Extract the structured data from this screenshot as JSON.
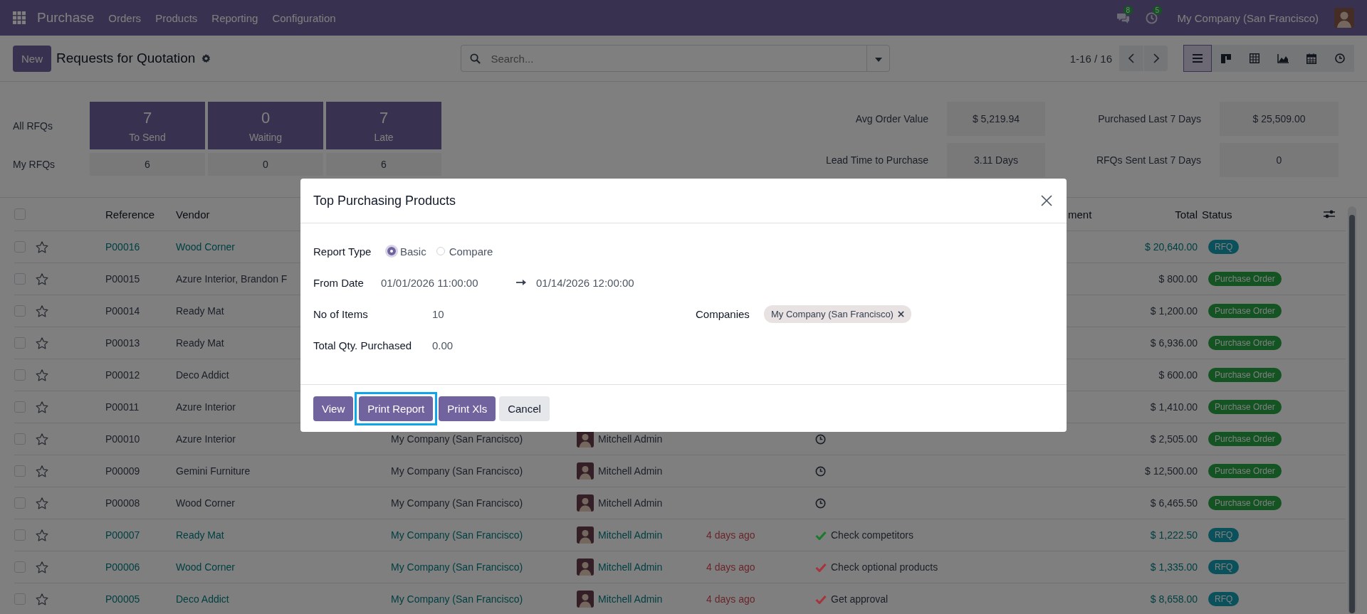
{
  "navbar": {
    "app": "Purchase",
    "menu": [
      "Orders",
      "Products",
      "Reporting",
      "Configuration"
    ],
    "messages_count": "8",
    "activities_count": "5",
    "company": "My Company (San Francisco)"
  },
  "control_panel": {
    "new_button": "New",
    "title": "Requests for Quotation",
    "search": {
      "placeholder": "Search..."
    },
    "pager": "1-16 / 16",
    "views": [
      {
        "kind": "list",
        "selected": true
      },
      {
        "kind": "kanban",
        "selected": false
      },
      {
        "kind": "pivot",
        "selected": false
      },
      {
        "kind": "graph",
        "selected": false
      },
      {
        "kind": "calendar",
        "selected": false
      },
      {
        "kind": "activity",
        "selected": false
      }
    ]
  },
  "dashboard": {
    "row_labels": [
      "All RFQs",
      "My RFQs"
    ],
    "tiles": [
      {
        "count": "7",
        "label": "To Send",
        "mine": "6"
      },
      {
        "count": "0",
        "label": "Waiting",
        "mine": "0"
      },
      {
        "count": "7",
        "label": "Late",
        "mine": "6"
      }
    ],
    "kpis": [
      {
        "label": "Avg Order Value",
        "value": "$ 5,219.94"
      },
      {
        "label": "Purchased Last 7 Days",
        "value": "$ 25,509.00"
      },
      {
        "label": "Lead Time to Purchase",
        "value": "3.11 Days"
      },
      {
        "label": "RFQs Sent Last 7 Days",
        "value": "0"
      }
    ]
  },
  "table": {
    "all_checked": false,
    "columns": {
      "reference": "Reference",
      "vendor": "Vendor",
      "activity": "ment",
      "total": "Total",
      "status": "Status"
    },
    "rows": [
      {
        "checked": false,
        "starred": false,
        "highlighted": true,
        "reference": "P00016",
        "vendor": "Wood Corner",
        "total": "$ 20,640.00",
        "status": {
          "label": "RFQ",
          "kind": "rfq"
        }
      },
      {
        "checked": false,
        "starred": false,
        "highlighted": false,
        "reference": "P00015",
        "vendor": "Azure Interior, Brandon F",
        "total": "$ 800.00",
        "status": {
          "label": "Purchase Order",
          "kind": "purchase"
        }
      },
      {
        "checked": false,
        "starred": false,
        "highlighted": false,
        "reference": "P00014",
        "vendor": "Ready Mat",
        "total": "$ 1,200.00",
        "status": {
          "label": "Purchase Order",
          "kind": "purchase"
        }
      },
      {
        "checked": false,
        "starred": false,
        "highlighted": false,
        "reference": "P00013",
        "vendor": "Ready Mat",
        "total": "$ 6,936.00",
        "status": {
          "label": "Purchase Order",
          "kind": "purchase"
        }
      },
      {
        "checked": false,
        "starred": false,
        "highlighted": false,
        "reference": "P00012",
        "vendor": "Deco Addict",
        "total": "$ 600.00",
        "status": {
          "label": "Purchase Order",
          "kind": "purchase"
        }
      },
      {
        "checked": false,
        "starred": false,
        "highlighted": false,
        "reference": "P00011",
        "vendor": "Azure Interior",
        "total": "$ 1,410.00",
        "status": {
          "label": "Purchase Order",
          "kind": "purchase"
        }
      },
      {
        "checked": false,
        "starred": false,
        "highlighted": false,
        "reference": "P00010",
        "vendor": "Azure Interior",
        "company": "My Company (San Francisco)",
        "buyer": "Mitchell Admin",
        "activity": {
          "kind": "clock"
        },
        "total": "$ 2,505.00",
        "status": {
          "label": "Purchase Order",
          "kind": "purchase"
        }
      },
      {
        "checked": false,
        "starred": false,
        "highlighted": false,
        "reference": "P00009",
        "vendor": "Gemini Furniture",
        "company": "My Company (San Francisco)",
        "buyer": "Mitchell Admin",
        "activity": {
          "kind": "clock"
        },
        "total": "$ 12,500.00",
        "status": {
          "label": "Purchase Order",
          "kind": "purchase"
        }
      },
      {
        "checked": false,
        "starred": false,
        "highlighted": false,
        "reference": "P00008",
        "vendor": "Wood Corner",
        "company": "My Company (San Francisco)",
        "buyer": "Mitchell Admin",
        "activity": {
          "kind": "clock"
        },
        "total": "$ 6,465.50",
        "status": {
          "label": "Purchase Order",
          "kind": "purchase"
        }
      },
      {
        "checked": false,
        "starred": false,
        "highlighted": true,
        "reference": "P00007",
        "vendor": "Ready Mat",
        "company": "My Company (San Francisco)",
        "buyer": "Mitchell Admin",
        "deadline": "4 days ago",
        "activity": {
          "kind": "check",
          "color": "#1a7a2a",
          "text": "Check competitors"
        },
        "total": "$ 1,222.50",
        "status": {
          "label": "RFQ",
          "kind": "rfq"
        }
      },
      {
        "checked": false,
        "starred": false,
        "highlighted": true,
        "reference": "P00006",
        "vendor": "Wood Corner",
        "company": "My Company (San Francisco)",
        "buyer": "Mitchell Admin",
        "deadline": "4 days ago",
        "activity": {
          "kind": "check",
          "color": "#a8333d",
          "text": "Check optional products"
        },
        "total": "$ 1,335.00",
        "status": {
          "label": "RFQ",
          "kind": "rfq"
        }
      },
      {
        "checked": false,
        "starred": false,
        "highlighted": true,
        "reference": "P00005",
        "vendor": "Deco Addict",
        "company": "My Company (San Francisco)",
        "buyer": "Mitchell Admin",
        "deadline": "4 days ago",
        "activity": {
          "kind": "check",
          "color": "#a8333d",
          "text": "Get approval"
        },
        "total": "$ 8,658.00",
        "status": {
          "label": "RFQ",
          "kind": "rfq"
        }
      }
    ]
  },
  "dialog": {
    "title": "Top Purchasing Products",
    "report_type": {
      "label": "Report Type",
      "options": [
        {
          "label": "Basic",
          "selected": true
        },
        {
          "label": "Compare",
          "selected": false
        }
      ]
    },
    "date_range": {
      "label": "From Date",
      "start": "01/01/2026 11:00:00",
      "end": "01/14/2026 12:00:00"
    },
    "items": {
      "label": "No of Items",
      "value": "10"
    },
    "companies": {
      "label": "Companies",
      "tags": [
        "My Company (San Francisco)"
      ]
    },
    "total_qty": {
      "label": "Total Qty. Purchased",
      "value": "0.00"
    },
    "buttons": [
      {
        "label": "View",
        "kind": "primary",
        "focused": false
      },
      {
        "label": "Print Report",
        "kind": "primary",
        "focused": true
      },
      {
        "label": "Print Xls",
        "kind": "primary",
        "focused": false
      },
      {
        "label": "Cancel",
        "kind": "secondary",
        "focused": false
      }
    ]
  }
}
